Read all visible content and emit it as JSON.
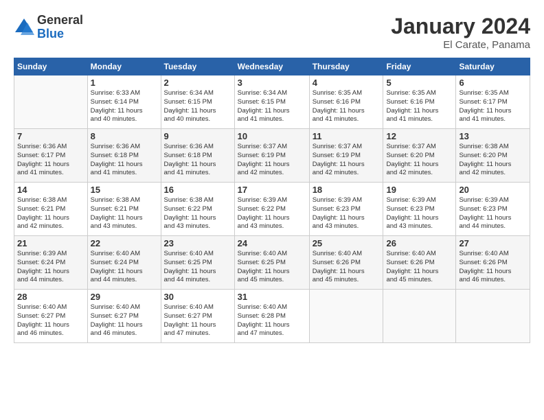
{
  "header": {
    "logo_general": "General",
    "logo_blue": "Blue",
    "title": "January 2024",
    "subtitle": "El Carate, Panama"
  },
  "columns": [
    "Sunday",
    "Monday",
    "Tuesday",
    "Wednesday",
    "Thursday",
    "Friday",
    "Saturday"
  ],
  "weeks": [
    [
      {
        "day": "",
        "info": ""
      },
      {
        "day": "1",
        "info": "Sunrise: 6:33 AM\nSunset: 6:14 PM\nDaylight: 11 hours\nand 40 minutes."
      },
      {
        "day": "2",
        "info": "Sunrise: 6:34 AM\nSunset: 6:15 PM\nDaylight: 11 hours\nand 40 minutes."
      },
      {
        "day": "3",
        "info": "Sunrise: 6:34 AM\nSunset: 6:15 PM\nDaylight: 11 hours\nand 41 minutes."
      },
      {
        "day": "4",
        "info": "Sunrise: 6:35 AM\nSunset: 6:16 PM\nDaylight: 11 hours\nand 41 minutes."
      },
      {
        "day": "5",
        "info": "Sunrise: 6:35 AM\nSunset: 6:16 PM\nDaylight: 11 hours\nand 41 minutes."
      },
      {
        "day": "6",
        "info": "Sunrise: 6:35 AM\nSunset: 6:17 PM\nDaylight: 11 hours\nand 41 minutes."
      }
    ],
    [
      {
        "day": "7",
        "info": "Sunrise: 6:36 AM\nSunset: 6:17 PM\nDaylight: 11 hours\nand 41 minutes."
      },
      {
        "day": "8",
        "info": "Sunrise: 6:36 AM\nSunset: 6:18 PM\nDaylight: 11 hours\nand 41 minutes."
      },
      {
        "day": "9",
        "info": "Sunrise: 6:36 AM\nSunset: 6:18 PM\nDaylight: 11 hours\nand 41 minutes."
      },
      {
        "day": "10",
        "info": "Sunrise: 6:37 AM\nSunset: 6:19 PM\nDaylight: 11 hours\nand 42 minutes."
      },
      {
        "day": "11",
        "info": "Sunrise: 6:37 AM\nSunset: 6:19 PM\nDaylight: 11 hours\nand 42 minutes."
      },
      {
        "day": "12",
        "info": "Sunrise: 6:37 AM\nSunset: 6:20 PM\nDaylight: 11 hours\nand 42 minutes."
      },
      {
        "day": "13",
        "info": "Sunrise: 6:38 AM\nSunset: 6:20 PM\nDaylight: 11 hours\nand 42 minutes."
      }
    ],
    [
      {
        "day": "14",
        "info": "Sunrise: 6:38 AM\nSunset: 6:21 PM\nDaylight: 11 hours\nand 42 minutes."
      },
      {
        "day": "15",
        "info": "Sunrise: 6:38 AM\nSunset: 6:21 PM\nDaylight: 11 hours\nand 43 minutes."
      },
      {
        "day": "16",
        "info": "Sunrise: 6:38 AM\nSunset: 6:22 PM\nDaylight: 11 hours\nand 43 minutes."
      },
      {
        "day": "17",
        "info": "Sunrise: 6:39 AM\nSunset: 6:22 PM\nDaylight: 11 hours\nand 43 minutes."
      },
      {
        "day": "18",
        "info": "Sunrise: 6:39 AM\nSunset: 6:23 PM\nDaylight: 11 hours\nand 43 minutes."
      },
      {
        "day": "19",
        "info": "Sunrise: 6:39 AM\nSunset: 6:23 PM\nDaylight: 11 hours\nand 43 minutes."
      },
      {
        "day": "20",
        "info": "Sunrise: 6:39 AM\nSunset: 6:23 PM\nDaylight: 11 hours\nand 44 minutes."
      }
    ],
    [
      {
        "day": "21",
        "info": "Sunrise: 6:39 AM\nSunset: 6:24 PM\nDaylight: 11 hours\nand 44 minutes."
      },
      {
        "day": "22",
        "info": "Sunrise: 6:40 AM\nSunset: 6:24 PM\nDaylight: 11 hours\nand 44 minutes."
      },
      {
        "day": "23",
        "info": "Sunrise: 6:40 AM\nSunset: 6:25 PM\nDaylight: 11 hours\nand 44 minutes."
      },
      {
        "day": "24",
        "info": "Sunrise: 6:40 AM\nSunset: 6:25 PM\nDaylight: 11 hours\nand 45 minutes."
      },
      {
        "day": "25",
        "info": "Sunrise: 6:40 AM\nSunset: 6:26 PM\nDaylight: 11 hours\nand 45 minutes."
      },
      {
        "day": "26",
        "info": "Sunrise: 6:40 AM\nSunset: 6:26 PM\nDaylight: 11 hours\nand 45 minutes."
      },
      {
        "day": "27",
        "info": "Sunrise: 6:40 AM\nSunset: 6:26 PM\nDaylight: 11 hours\nand 46 minutes."
      }
    ],
    [
      {
        "day": "28",
        "info": "Sunrise: 6:40 AM\nSunset: 6:27 PM\nDaylight: 11 hours\nand 46 minutes."
      },
      {
        "day": "29",
        "info": "Sunrise: 6:40 AM\nSunset: 6:27 PM\nDaylight: 11 hours\nand 46 minutes."
      },
      {
        "day": "30",
        "info": "Sunrise: 6:40 AM\nSunset: 6:27 PM\nDaylight: 11 hours\nand 47 minutes."
      },
      {
        "day": "31",
        "info": "Sunrise: 6:40 AM\nSunset: 6:28 PM\nDaylight: 11 hours\nand 47 minutes."
      },
      {
        "day": "",
        "info": ""
      },
      {
        "day": "",
        "info": ""
      },
      {
        "day": "",
        "info": ""
      }
    ]
  ]
}
